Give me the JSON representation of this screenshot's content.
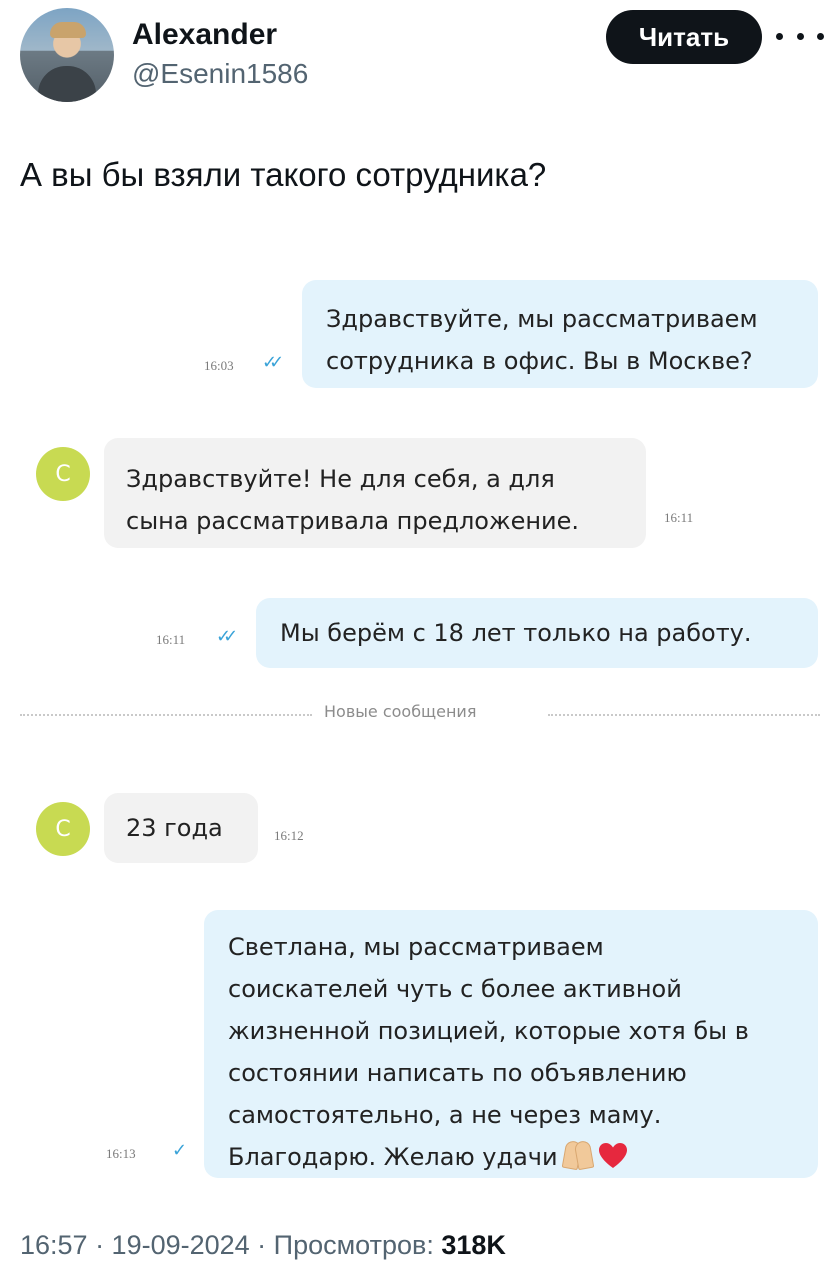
{
  "author": {
    "display_name": "Alexander",
    "handle": "@Esenin1586",
    "follow_label": "Читать"
  },
  "tweet": {
    "text": "А вы бы взяли такого сотрудника?",
    "timestamp": "16:57 · 19-09-2024 · Просмотров:",
    "views": "318K"
  },
  "chat": {
    "contact_initial": "С",
    "new_messages_label": "Новые сообщения",
    "messages": [
      {
        "direction": "outgoing",
        "lines": [
          "Здравствуйте, мы рассматриваем",
          "сотрудника в офис. Вы в Москве?"
        ],
        "time": "16:03",
        "status": "read"
      },
      {
        "direction": "incoming",
        "lines": [
          "Здравствуйте! Не для себя, а для",
          "сына рассматривала предложение."
        ],
        "time": "16:11"
      },
      {
        "direction": "outgoing",
        "lines": [
          "Мы берём с 18 лет только на работу."
        ],
        "time": "16:11",
        "status": "read"
      },
      {
        "direction": "incoming",
        "lines": [
          "23 года"
        ],
        "time": "16:12"
      },
      {
        "direction": "outgoing",
        "lines": [
          "Светлана, мы рассматриваем",
          "соискателей чуть с более активной",
          "жизненной позицией, которые хотя бы в",
          "состоянии написать по объявлению",
          "самостоятельно, а не через маму.",
          "Благодарю. Желаю удачи"
        ],
        "emoji": [
          "folded-hands",
          "red-heart"
        ],
        "time": "16:13",
        "status": "sent"
      }
    ]
  },
  "colors": {
    "outgoing_bubble": "#e3f3fc",
    "incoming_bubble": "#f2f2f2",
    "contact_avatar": "#c8da52",
    "read_ticks": "#3aa3d8",
    "follow_button": "#0f1419"
  }
}
